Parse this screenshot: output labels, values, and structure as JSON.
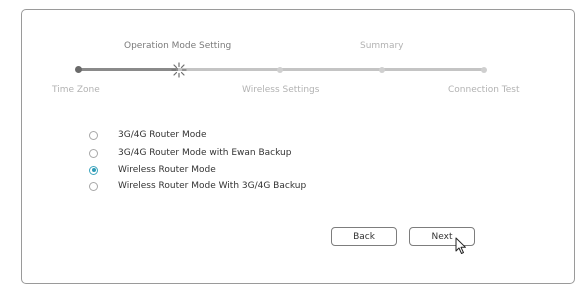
{
  "wizard": {
    "steps_top": [
      "Operation Mode Setting",
      "Summary"
    ],
    "steps_bottom": [
      "Time Zone",
      "Wireless Settings",
      "Connection Test"
    ],
    "current_step_icon": "loading-spinner-icon"
  },
  "options": [
    {
      "label": "3G/4G Router Mode",
      "checked": false
    },
    {
      "label": "3G/4G Router Mode with Ewan Backup",
      "checked": false
    },
    {
      "label": "Wireless Router Mode",
      "checked": true
    },
    {
      "label": "Wireless Router Mode With 3G/4G Backup",
      "checked": false
    }
  ],
  "buttons": {
    "back": "Back",
    "next": "Next"
  },
  "colors": {
    "accent": "#2e9bb6"
  },
  "icons": {
    "cursor": "mouse-pointer-icon"
  }
}
